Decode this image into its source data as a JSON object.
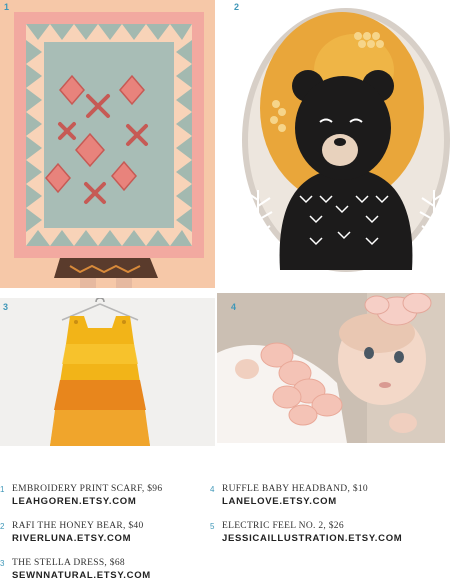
{
  "items": [
    {
      "number": "1",
      "title": "EMBROIDERY PRINT SCARF, $96",
      "shop": "LEAHGOREN.ETSY.COM"
    },
    {
      "number": "2",
      "title": "RAFI THE HONEY BEAR, $40",
      "shop": "RIVERLUNA.ETSY.COM"
    },
    {
      "number": "3",
      "title": "THE STELLA DRESS, $68",
      "shop": "SEWNNATURAL.ETSY.COM"
    },
    {
      "number": "4",
      "title": "RUFFLE BABY HEADBAND, $10",
      "shop": "LANELOVE.ETSY.COM"
    },
    {
      "number": "5",
      "title": "ELECTRIC FEEL NO. 2, $26",
      "shop": "JESSICAILLUSTRATION.ETSY.COM"
    }
  ],
  "colors": {
    "number_accent": "#3f97b8",
    "scarf_border": "#f6c6a6",
    "scarf_center": "#9fb8b0",
    "bear_gold": "#e9a63a",
    "bear_body": "#1c1b1b",
    "dress_yellow": "#f2b418",
    "dress_orange": "#e8861c",
    "headband_pink": "#f4c3b6"
  }
}
